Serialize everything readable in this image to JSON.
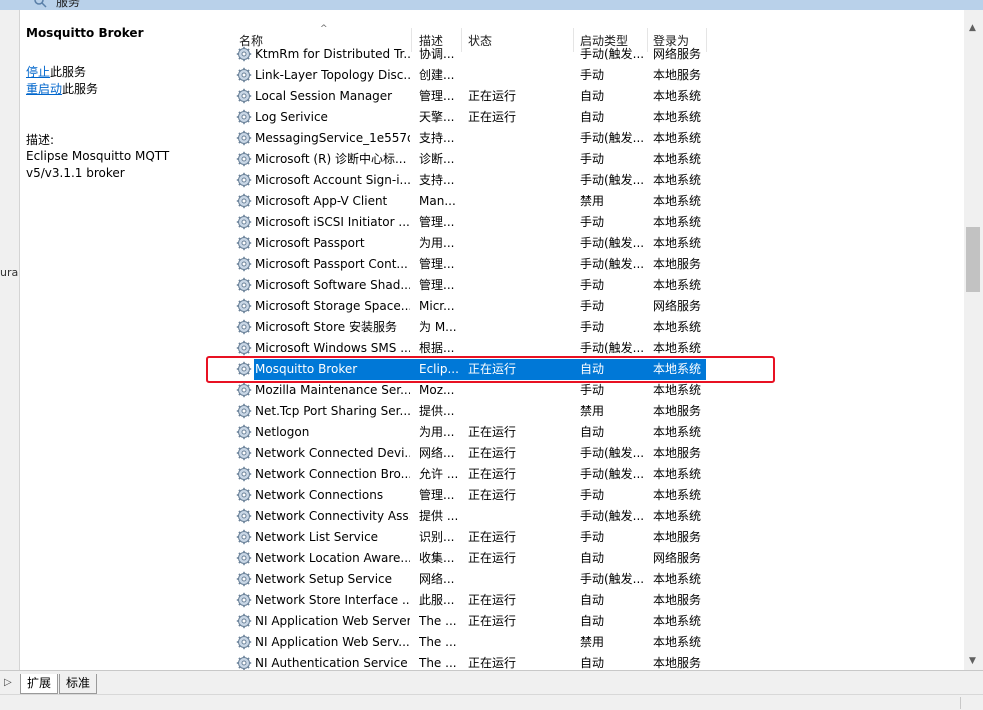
{
  "window": {
    "title": "服务",
    "title_icon": "search-icon"
  },
  "left_strip": {
    "partial_text": "ura"
  },
  "description_panel": {
    "service_name": "Mosquitto Broker",
    "actions": [
      {
        "link": "停止",
        "suffix": "此服务"
      },
      {
        "link": "重启动",
        "suffix": "此服务"
      }
    ],
    "description_label": "描述:",
    "description_text": "Eclipse Mosquitto MQTT v5/v3.1.1 broker"
  },
  "table": {
    "columns": {
      "name": "名称",
      "desc": "描述",
      "status": "状态",
      "startup": "启动类型",
      "logon": "登录为"
    },
    "sort_indicator": "^",
    "selected_index": 15,
    "rows": [
      {
        "name": "KtmRm for Distributed Tr...",
        "desc": "协调...",
        "status": "",
        "startup": "手动(触发...",
        "logon": "网络服务"
      },
      {
        "name": "Link-Layer Topology Disc...",
        "desc": "创建...",
        "status": "",
        "startup": "手动",
        "logon": "本地服务"
      },
      {
        "name": "Local Session Manager",
        "desc": "管理...",
        "status": "正在运行",
        "startup": "自动",
        "logon": "本地系统"
      },
      {
        "name": "Log Serivice",
        "desc": "天擎...",
        "status": "正在运行",
        "startup": "自动",
        "logon": "本地系统"
      },
      {
        "name": "MessagingService_1e557d",
        "desc": "支持...",
        "status": "",
        "startup": "手动(触发...",
        "logon": "本地系统"
      },
      {
        "name": "Microsoft (R) 诊断中心标...",
        "desc": "诊断...",
        "status": "",
        "startup": "手动",
        "logon": "本地系统"
      },
      {
        "name": "Microsoft Account Sign-i...",
        "desc": "支持...",
        "status": "",
        "startup": "手动(触发...",
        "logon": "本地系统"
      },
      {
        "name": "Microsoft App-V Client",
        "desc": "Man...",
        "status": "",
        "startup": "禁用",
        "logon": "本地系统"
      },
      {
        "name": "Microsoft iSCSI Initiator ...",
        "desc": "管理...",
        "status": "",
        "startup": "手动",
        "logon": "本地系统"
      },
      {
        "name": "Microsoft Passport",
        "desc": "为用...",
        "status": "",
        "startup": "手动(触发...",
        "logon": "本地系统"
      },
      {
        "name": "Microsoft Passport Cont...",
        "desc": "管理...",
        "status": "",
        "startup": "手动(触发...",
        "logon": "本地服务"
      },
      {
        "name": "Microsoft Software Shad...",
        "desc": "管理...",
        "status": "",
        "startup": "手动",
        "logon": "本地系统"
      },
      {
        "name": "Microsoft Storage Space...",
        "desc": "Micr...",
        "status": "",
        "startup": "手动",
        "logon": "网络服务"
      },
      {
        "name": "Microsoft Store 安装服务",
        "desc": "为 M...",
        "status": "",
        "startup": "手动",
        "logon": "本地系统"
      },
      {
        "name": "Microsoft Windows SMS ...",
        "desc": "根据...",
        "status": "",
        "startup": "手动(触发...",
        "logon": "本地系统"
      },
      {
        "name": "Mosquitto Broker",
        "desc": "Eclip...",
        "status": "正在运行",
        "startup": "自动",
        "logon": "本地系统"
      },
      {
        "name": "Mozilla Maintenance Ser...",
        "desc": "Moz...",
        "status": "",
        "startup": "手动",
        "logon": "本地系统"
      },
      {
        "name": "Net.Tcp Port Sharing Ser...",
        "desc": "提供...",
        "status": "",
        "startup": "禁用",
        "logon": "本地服务"
      },
      {
        "name": "Netlogon",
        "desc": "为用...",
        "status": "正在运行",
        "startup": "自动",
        "logon": "本地系统"
      },
      {
        "name": "Network Connected Devi...",
        "desc": "网络...",
        "status": "正在运行",
        "startup": "手动(触发...",
        "logon": "本地服务"
      },
      {
        "name": "Network Connection Bro...",
        "desc": "允许 ...",
        "status": "正在运行",
        "startup": "手动(触发...",
        "logon": "本地系统"
      },
      {
        "name": "Network Connections",
        "desc": "管理...",
        "status": "正在运行",
        "startup": "手动",
        "logon": "本地系统"
      },
      {
        "name": "Network Connectivity Ass...",
        "desc": "提供 ...",
        "status": "",
        "startup": "手动(触发...",
        "logon": "本地系统"
      },
      {
        "name": "Network List Service",
        "desc": "识别...",
        "status": "正在运行",
        "startup": "手动",
        "logon": "本地服务"
      },
      {
        "name": "Network Location Aware...",
        "desc": "收集...",
        "status": "正在运行",
        "startup": "自动",
        "logon": "网络服务"
      },
      {
        "name": "Network Setup Service",
        "desc": "网络...",
        "status": "",
        "startup": "手动(触发...",
        "logon": "本地系统"
      },
      {
        "name": "Network Store Interface ...",
        "desc": "此服...",
        "status": "正在运行",
        "startup": "自动",
        "logon": "本地服务"
      },
      {
        "name": "NI Application Web Server",
        "desc": "The ...",
        "status": "正在运行",
        "startup": "自动",
        "logon": "本地系统"
      },
      {
        "name": "NI Application Web Serv...",
        "desc": "The ...",
        "status": "",
        "startup": "禁用",
        "logon": "本地系统"
      },
      {
        "name": "NI Authentication Service",
        "desc": "The ...",
        "status": "正在运行",
        "startup": "自动",
        "logon": "本地服务"
      }
    ]
  },
  "tabs": [
    {
      "label": "扩展",
      "active": true
    },
    {
      "label": "标准",
      "active": false
    }
  ],
  "colors": {
    "selection": "#0078d7",
    "highlight_border": "#e81123",
    "link": "#0066cc"
  },
  "icons": {
    "service": "gear-icon",
    "scroll_up": "chevron-up-icon",
    "scroll_down": "chevron-down-icon",
    "tab_nav": "chevron-right-icon"
  }
}
